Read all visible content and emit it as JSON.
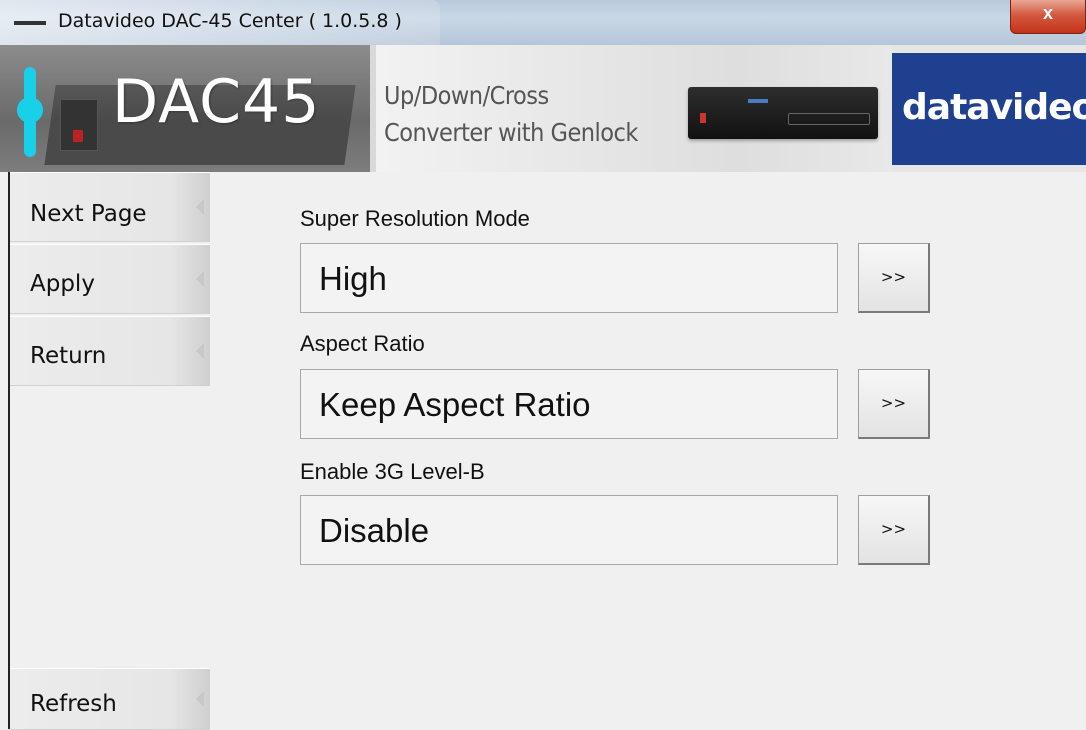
{
  "window": {
    "title": "Datavideo DAC-45 Center ( 1.0.5.8 )",
    "close_label": "x"
  },
  "banner": {
    "model": "DAC45",
    "tagline_line1": "Up/Down/Cross",
    "tagline_line2": "Converter with Genlock",
    "brand": "datavideo",
    "accent_color": "#18d1e8",
    "brand_color": "#1f3f8f"
  },
  "sidebar": {
    "items": [
      {
        "label": "Next Page"
      },
      {
        "label": "Apply"
      },
      {
        "label": "Return"
      }
    ],
    "refresh_label": "Refresh"
  },
  "settings": [
    {
      "label": "Super Resolution Mode",
      "value": "High",
      "button": ">>"
    },
    {
      "label": "Aspect Ratio",
      "value": "Keep Aspect Ratio",
      "button": ">>"
    },
    {
      "label": "Enable 3G Level-B",
      "value": "Disable",
      "button": ">>"
    }
  ]
}
